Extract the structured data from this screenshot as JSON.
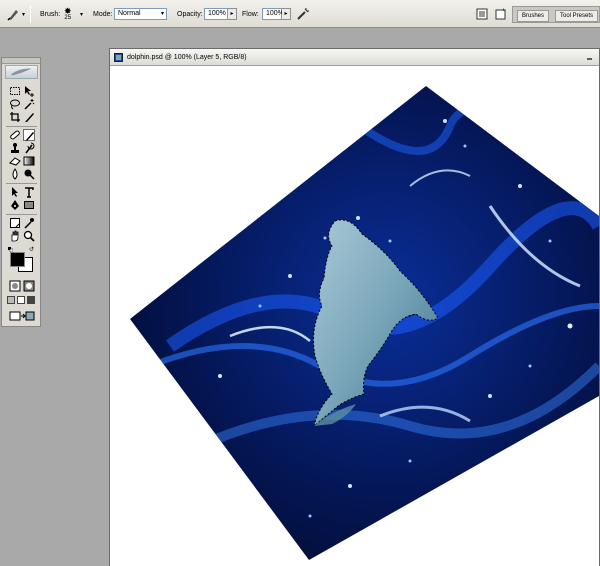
{
  "options_bar": {
    "brush_label": "Brush:",
    "brush_size": "25",
    "mode_label": "Mode:",
    "mode_value": "Normal",
    "opacity_label": "Opacity:",
    "opacity_value": "100%",
    "flow_label": "Flow:",
    "flow_value": "100%"
  },
  "palette_well": {
    "tabs": [
      "Brushes",
      "Tool Presets"
    ]
  },
  "document": {
    "title": "dolphin.psd @ 100% (Layer 5, RGB/8)"
  },
  "colors": {
    "foreground": "#000000",
    "background": "#ffffff",
    "image_dark": "#020a2a",
    "image_blue": "#0a3fd8",
    "dolphin": "#7aa6ba"
  }
}
